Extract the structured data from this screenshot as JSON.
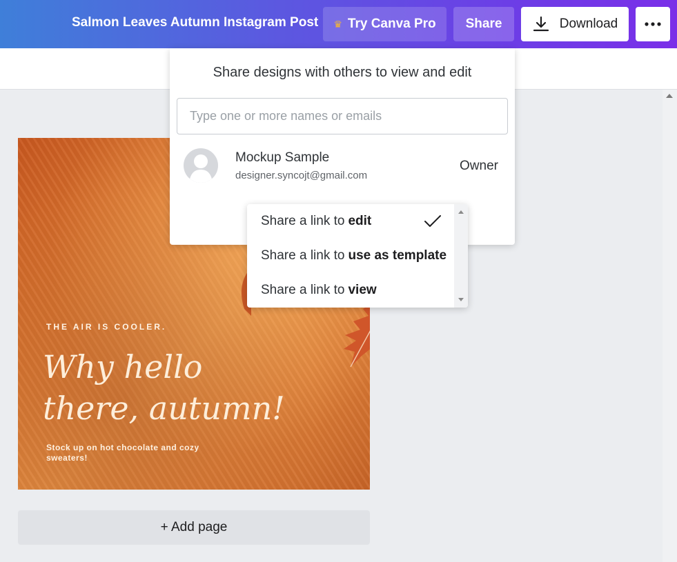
{
  "header": {
    "title": "Salmon Leaves Autumn Instagram Post",
    "try_pro_label": "Try Canva Pro",
    "share_label": "Share",
    "download_label": "Download",
    "more_icon": "more-horizontal-icon",
    "colors": {
      "gradient_start": "#3f7fd9",
      "gradient_end": "#7a2fe8",
      "crown": "#f5b731"
    }
  },
  "share_panel": {
    "heading": "Share designs with others to view and edit",
    "input_placeholder": "Type one or more names or emails",
    "input_value": "",
    "member": {
      "name": "Mockup Sample",
      "email": "designer.syncojt@gmail.com",
      "role": "Owner"
    }
  },
  "link_menu": {
    "items": [
      {
        "prefix": "Share a link to",
        "emphasis": "edit",
        "selected": true
      },
      {
        "prefix": "Share a link to",
        "emphasis": "use as template",
        "selected": false
      },
      {
        "prefix": "Share a link to",
        "emphasis": "view",
        "selected": false
      }
    ]
  },
  "design": {
    "kicker": "THE AIR IS COOLER.",
    "headline_line1": "Why hello",
    "headline_line2": "there, autumn!",
    "subtext": "Stock up on hot chocolate and cozy sweaters!",
    "background_color": "#dd7a33"
  },
  "add_page_label": "+ Add page"
}
